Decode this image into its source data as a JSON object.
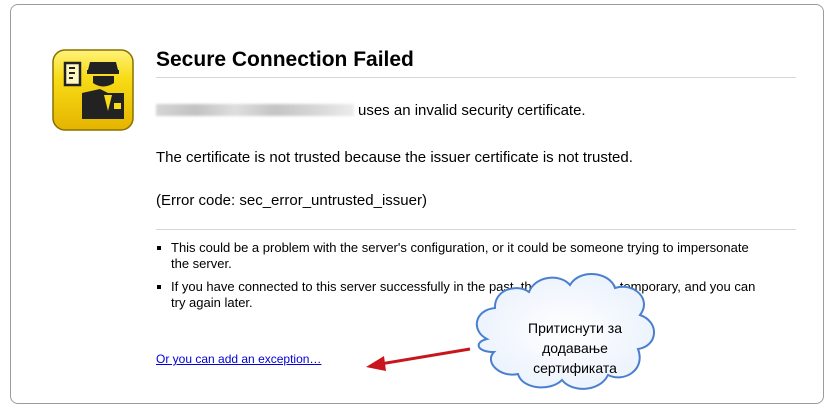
{
  "error_page": {
    "title": "Secure Connection Failed",
    "cert_message": "uses an invalid security certificate.",
    "not_trusted": "The certificate is not trusted because the issuer certificate is not trusted.",
    "error_code": "(Error code: sec_error_untrusted_issuer)",
    "advice": [
      "This could be a problem with the server's configuration, or it could be someone trying to impersonate the server.",
      "If you have connected to this server successfully in the past, the error may be temporary, and you can try again later."
    ],
    "exception_link": "Or you can add an exception…"
  },
  "annotation": {
    "line1": "Притиснути за",
    "line2": "додавање",
    "line3": "сертификата",
    "arrow_color": "#c8161d",
    "cloud_stroke": "#4a7fd0"
  },
  "colors": {
    "icon_yellow": "#f5d20a",
    "link": "#0000d8"
  }
}
